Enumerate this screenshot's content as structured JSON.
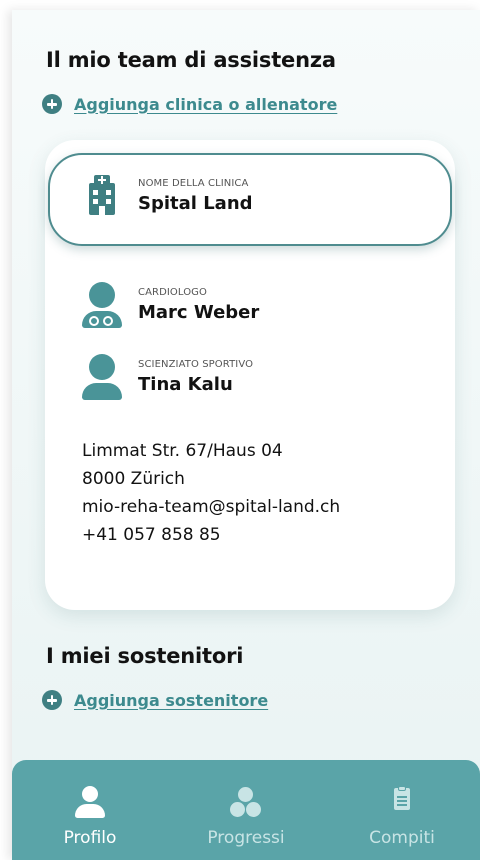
{
  "care_team": {
    "title": "Il mio team di assistenza",
    "add_label": "Aggiunga clinica o allenatore",
    "clinic": {
      "caption": "NOME DELLA CLINICA",
      "name": "Spital Land"
    },
    "members": [
      {
        "caption": "CARDIOLOGO",
        "name": "Marc Weber",
        "icon": "doctor-icon"
      },
      {
        "caption": "SCIENZIATO SPORTIVO",
        "name": "Tina Kalu",
        "icon": "person-icon"
      }
    ],
    "address": {
      "street": "Limmat Str. 67/Haus 04",
      "city": "8000 Zürich",
      "email": "mio-reha-team@spital-land.ch",
      "phone": "+41 057 858 85"
    }
  },
  "supporters": {
    "title": "I miei sostenitori",
    "add_label": "Aggiunga sostenitore"
  },
  "tabbar": {
    "tabs": [
      {
        "label": "Profilo",
        "icon": "person-icon",
        "active": true
      },
      {
        "label": "Progressi",
        "icon": "progress-icon",
        "active": false
      },
      {
        "label": "Compiti",
        "icon": "clipboard-icon",
        "active": false
      }
    ]
  },
  "colors": {
    "accent": "#3f7f82",
    "link": "#3d8a8e",
    "tabbar": "#5aa4a8",
    "tab_inactive": "#c8e4e5"
  }
}
